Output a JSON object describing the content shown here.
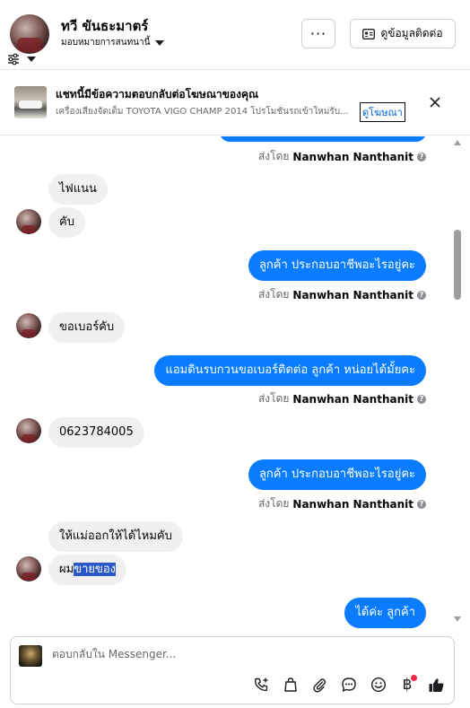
{
  "header": {
    "contact_name": "ทวี ขันธะมาตร์",
    "assign_label": "มอบหมายการสนทนานี้",
    "more_label": "···",
    "contact_info_label": "ดูข้อมูลติดต่อ"
  },
  "ad_banner": {
    "title": "แชทนี้มีข้อความตอบกลับต่อโฆษณาของคุณ",
    "text": "เครื่องเสียงจัดเต็ม TOYOTA VIGO CHAMP 2014 โปรโมชั่นรถเข้าใหม่รับ...",
    "link_label": "ดูโฆษณา"
  },
  "messages": {
    "sent_by_label": "ส่งโดย",
    "sender_name": "Nanwhan Nanthanit",
    "info_glyph": "?",
    "items": [
      {
        "direction": "in",
        "text": "ไฟแนน"
      },
      {
        "direction": "in",
        "text": "คับ"
      },
      {
        "direction": "out",
        "text": "ลูกค้า ประกอบอาชีพอะไรอยู่คะ"
      },
      {
        "direction": "in",
        "text": "ขอเบอร์คับ"
      },
      {
        "direction": "out",
        "text": "แอมดินรบกวนขอเบอร์ติดต่อ ลูกค้า หน่อยได้มั้ยคะ"
      },
      {
        "direction": "in",
        "text": "0623784005"
      },
      {
        "direction": "out",
        "text": "ลูกค้า ประกอบอาชีพอะไรอยู่คะ"
      },
      {
        "direction": "in",
        "text": "ให้แม่ออกให้ได้ไหมคับ"
      },
      {
        "direction": "in",
        "text_plain": "ผม",
        "text_selected": "ขายของ"
      },
      {
        "direction": "out",
        "text": "ได้ค่ะ  ลูกค้า"
      }
    ]
  },
  "composer": {
    "placeholder": "ตอบกลับใน Messenger...",
    "tools": [
      "phone-add-icon",
      "shopping-bag-icon",
      "paperclip-icon",
      "chat-bubble-icon",
      "emoji-icon",
      "baht-icon",
      "thumbs-up-icon"
    ],
    "baht_glyph": "฿"
  },
  "colors": {
    "outgoing_bubble": "#0a7cff",
    "incoming_bubble": "#f0f0f0",
    "selection": "#2b57c8",
    "notification_dot": "#f02849"
  }
}
